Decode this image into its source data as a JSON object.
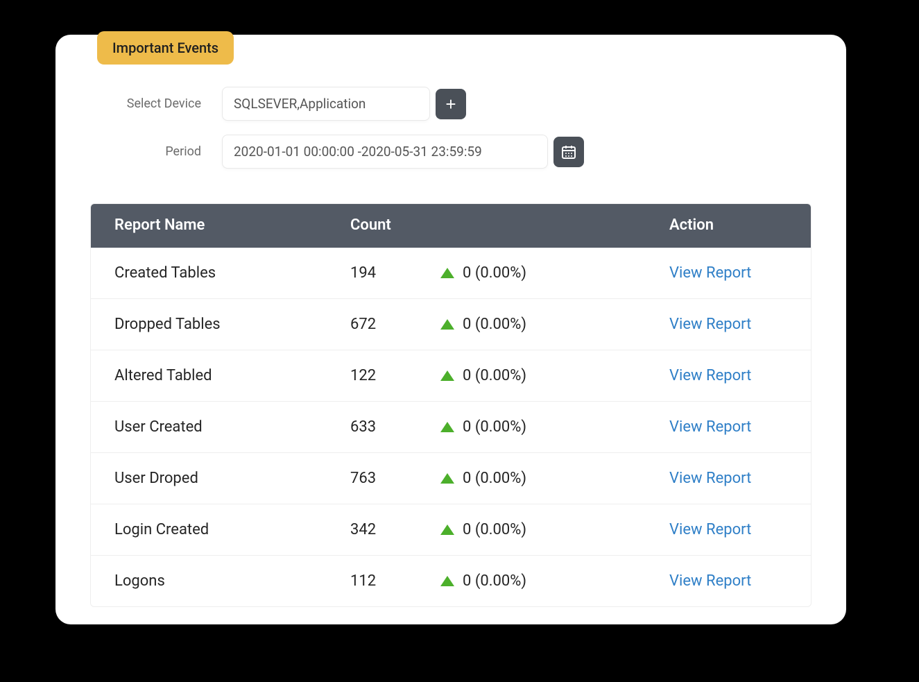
{
  "tab_label": "Important Events",
  "filters": {
    "device_label": "Select Device",
    "device_value": "SQLSEVER,Application",
    "period_label": "Period",
    "period_value": "2020-01-01 00:00:00 -2020-05-31 23:59:59"
  },
  "table": {
    "headers": {
      "name": "Report Name",
      "count": "Count",
      "action": "Action"
    },
    "action_link_label": "View Report",
    "rows": [
      {
        "name": "Created Tables",
        "count": "194",
        "delta": "0 (0.00%)"
      },
      {
        "name": "Dropped Tables",
        "count": "672",
        "delta": "0 (0.00%)"
      },
      {
        "name": "Altered Tabled",
        "count": "122",
        "delta": "0 (0.00%)"
      },
      {
        "name": "User Created",
        "count": "633",
        "delta": "0 (0.00%)"
      },
      {
        "name": "User Droped",
        "count": "763",
        "delta": "0 (0.00%)"
      },
      {
        "name": "Login Created",
        "count": "342",
        "delta": "0 (0.00%)"
      },
      {
        "name": "Logons",
        "count": "112",
        "delta": "0 (0.00%)"
      }
    ]
  }
}
